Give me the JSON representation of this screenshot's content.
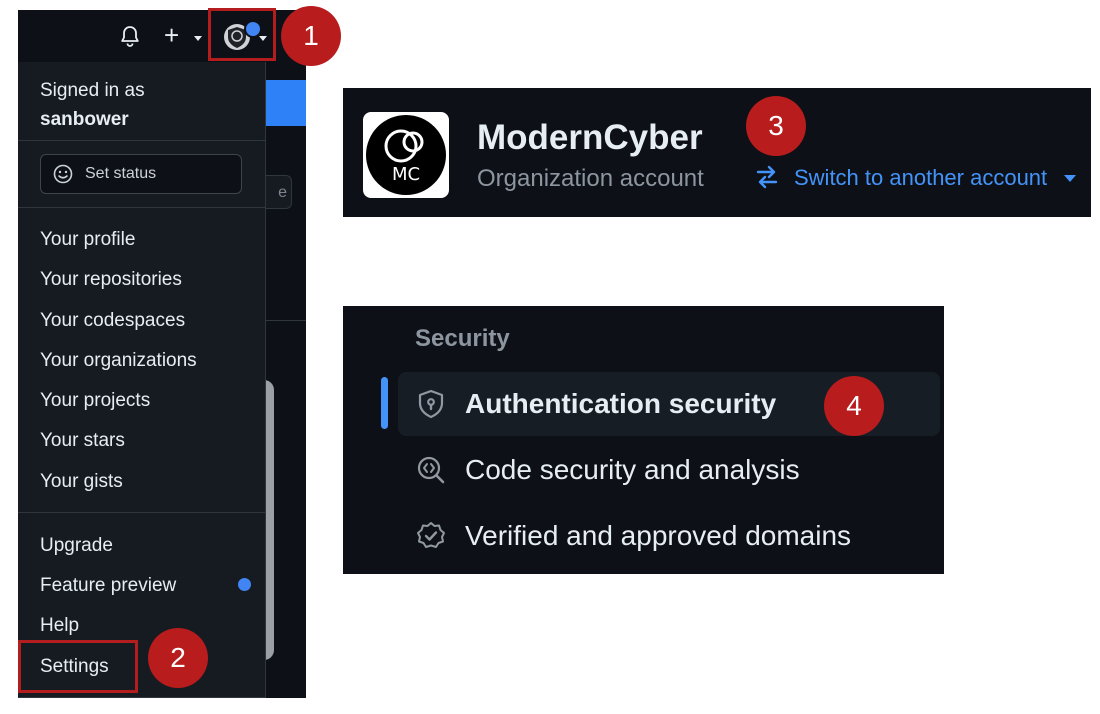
{
  "header": {
    "plus_label": "+"
  },
  "user_menu": {
    "signed_in_prefix": "Signed in as",
    "username": "sanbower",
    "set_status_label": "Set status",
    "items_primary": [
      {
        "label": "Your profile"
      },
      {
        "label": "Your repositories"
      },
      {
        "label": "Your codespaces"
      },
      {
        "label": "Your organizations"
      },
      {
        "label": "Your projects"
      },
      {
        "label": "Your stars"
      },
      {
        "label": "Your gists"
      }
    ],
    "items_secondary": [
      {
        "label": "Upgrade"
      },
      {
        "label": "Feature preview"
      },
      {
        "label": "Help"
      },
      {
        "label": "Settings"
      }
    ]
  },
  "background": {
    "partial_button_text": "e"
  },
  "annotations": [
    {
      "number": "1"
    },
    {
      "number": "2"
    },
    {
      "number": "3"
    },
    {
      "number": "4"
    }
  ],
  "organization": {
    "name": "ModernCyber",
    "type": "Organization account",
    "switch_label": "Switch to another account",
    "logo_text": "MC"
  },
  "security_nav": {
    "section_title": "Security",
    "items": [
      {
        "label": "Authentication security",
        "icon": "shield-lock-icon",
        "active": true
      },
      {
        "label": "Code security and analysis",
        "icon": "codescan-icon",
        "active": false
      },
      {
        "label": "Verified and approved domains",
        "icon": "verified-icon",
        "active": false
      }
    ]
  },
  "colors": {
    "accent_blue": "#4493f8",
    "annotation_red": "#b81c1c",
    "dark_bg": "#0d1117",
    "menu_bg": "#161b22"
  }
}
